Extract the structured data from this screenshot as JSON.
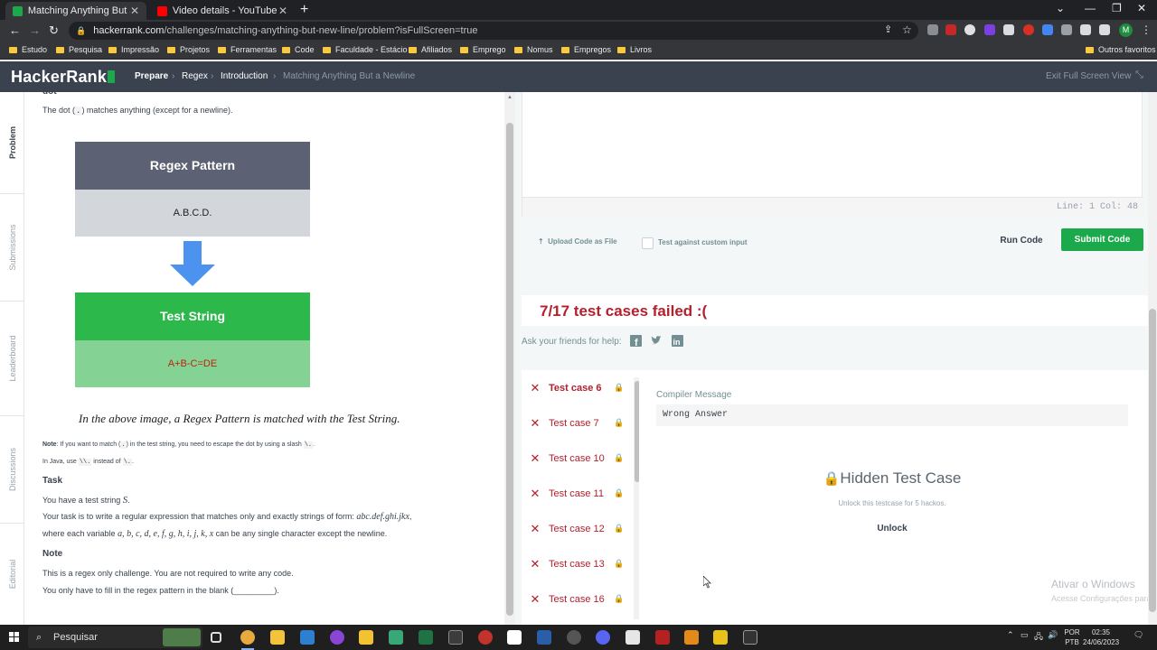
{
  "browser": {
    "tabs": [
      {
        "title": "Matching Anything But a Newline",
        "active": true
      },
      {
        "title": "Video details - YouTube Studio",
        "active": false
      }
    ],
    "url_host": "hackerrank.com",
    "url_path": "/challenges/matching-anything-but-new-line/problem?isFullScreen=true",
    "bookmarks": [
      "Estudo",
      "Pesquisa",
      "Impressão",
      "Projetos",
      "Ferramentas",
      "Code",
      "Faculdade - Estácio",
      "Afiliados",
      "Emprego",
      "Nomus",
      "Empregos",
      "Livros"
    ],
    "other_bookmarks": "Outros favoritos",
    "profile_initial": "M"
  },
  "header": {
    "logo": "HackerRank",
    "breadcrumbs": [
      "Prepare",
      "Regex",
      "Introduction",
      "Matching Anything But a Newline"
    ],
    "exit_fullscreen": "Exit Full Screen View"
  },
  "rail": [
    "Problem",
    "Submissions",
    "Leaderboard",
    "Discussions",
    "Editorial"
  ],
  "problem": {
    "clipped_heading": "dot",
    "intro_prefix": "The dot (",
    "intro_code": ".",
    "intro_suffix": ") matches anything (except for a newline).",
    "diagram": {
      "pattern_title": "Regex Pattern",
      "pattern_value": "A.B.C.D.",
      "test_title": "Test String",
      "test_value": "A+B-C=DE"
    },
    "caption": "In the above image, a Regex Pattern is matched with the Test String.",
    "note_label": "Note",
    "note_text_a": ": If you want to match (",
    "note_code_a": ".",
    "note_text_b": ") in the test string, you need to escape the dot by using a slash ",
    "note_code_b": "\\.",
    "note_text_c": ".",
    "java_text_a": "In Java, use ",
    "java_code_a": "\\\\.",
    "java_text_b": " instead of ",
    "java_code_b": "\\.",
    "java_text_c": ".",
    "task_heading": "Task",
    "task_line1_a": "You have a test string ",
    "task_line1_math": "S",
    "task_line1_b": ".",
    "task_line2_a": "Your task is to write a regular expression that matches only and exactly strings of form: ",
    "task_line2_math": "abc.def.ghi.jkx",
    "task_line2_b": ",",
    "task_line3_a": "where each variable ",
    "task_line3_math": "a, b, c, d, e, f, g, h, i, j, k, x",
    "task_line3_b": " can be any single character except the newline.",
    "note2_heading": "Note",
    "note2_line1": "This is a regex only challenge. You are not required to write any code.",
    "note2_line2_a": "You only have to fill in the regex pattern in the blank (",
    "note2_line2_blank": "_________",
    "note2_line2_b": ")."
  },
  "editor": {
    "line_info": "Line: 1 Col: 48",
    "upload": "Upload Code as File",
    "custom_input": "Test against custom input",
    "run": "Run Code",
    "submit": "Submit Code"
  },
  "results": {
    "title": "7/17 test cases failed :(",
    "friends": "Ask your friends for help:",
    "testcases": [
      "Test case 6",
      "Test case 7",
      "Test case 10",
      "Test case 11",
      "Test case 12",
      "Test case 13",
      "Test case 16"
    ],
    "compiler_label": "Compiler Message",
    "compiler_message": "Wrong Answer",
    "hidden_title": "Hidden Test Case",
    "hidden_sub": "Unlock this testcase for 5 hackos.",
    "unlock": "Unlock"
  },
  "watermark": {
    "line1": "Ativar o Windows",
    "line2": "Acesse Configurações para ativar o Windows."
  },
  "taskbar": {
    "search": "Pesquisar",
    "lang1": "POR",
    "lang2": "PTB",
    "time": "02:35",
    "date": "24/06/2023"
  },
  "colors": {
    "hr_green": "#1ba94c",
    "hr_header": "#39424e",
    "fail_red": "#b3202e"
  }
}
